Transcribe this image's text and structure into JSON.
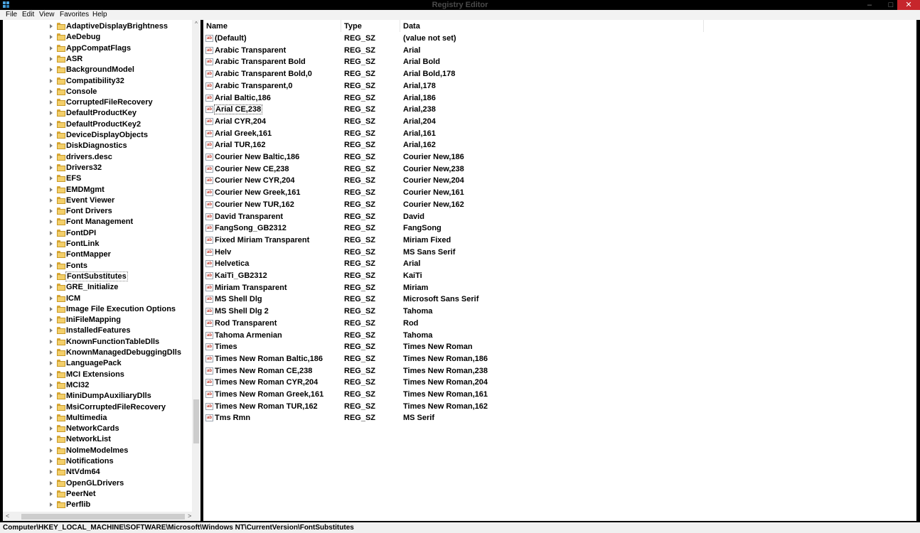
{
  "window": {
    "title": "Registry Editor",
    "minimize_glyph": "–",
    "maximize_glyph": "□",
    "close_glyph": "✕"
  },
  "menu": [
    "File",
    "Edit",
    "View",
    "Favorites",
    "Help"
  ],
  "tree": {
    "items": [
      "AdaptiveDisplayBrightness",
      "AeDebug",
      "AppCompatFlags",
      "ASR",
      "BackgroundModel",
      "Compatibility32",
      "Console",
      "CorruptedFileRecovery",
      "DefaultProductKey",
      "DefaultProductKey2",
      "DeviceDisplayObjects",
      "DiskDiagnostics",
      "drivers.desc",
      "Drivers32",
      "EFS",
      "EMDMgmt",
      "Event Viewer",
      "Font Drivers",
      "Font Management",
      "FontDPI",
      "FontLink",
      "FontMapper",
      "Fonts",
      "FontSubstitutes",
      "GRE_Initialize",
      "ICM",
      "Image File Execution Options",
      "IniFileMapping",
      "InstalledFeatures",
      "KnownFunctionTableDlls",
      "KnownManagedDebuggingDlls",
      "LanguagePack",
      "MCI Extensions",
      "MCI32",
      "MiniDumpAuxiliaryDlls",
      "MsiCorruptedFileRecovery",
      "Multimedia",
      "NetworkCards",
      "NetworkList",
      "NoImeModelmes",
      "Notifications",
      "NtVdm64",
      "OpenGLDrivers",
      "PeerNet",
      "Perflib"
    ],
    "selected": "FontSubstitutes",
    "scroll_up_glyph": "^",
    "scroll_left_glyph": "<",
    "scroll_right_glyph": ">"
  },
  "list": {
    "columns": [
      "Name",
      "Type",
      "Data"
    ],
    "icon_text": "ab",
    "focused": "Arial CE,238",
    "rows": [
      {
        "name": "(Default)",
        "type": "REG_SZ",
        "data": "(value not set)"
      },
      {
        "name": "Arabic Transparent",
        "type": "REG_SZ",
        "data": "Arial"
      },
      {
        "name": "Arabic Transparent Bold",
        "type": "REG_SZ",
        "data": "Arial Bold"
      },
      {
        "name": "Arabic Transparent Bold,0",
        "type": "REG_SZ",
        "data": "Arial Bold,178"
      },
      {
        "name": "Arabic Transparent,0",
        "type": "REG_SZ",
        "data": "Arial,178"
      },
      {
        "name": "Arial Baltic,186",
        "type": "REG_SZ",
        "data": "Arial,186"
      },
      {
        "name": "Arial CE,238",
        "type": "REG_SZ",
        "data": "Arial,238"
      },
      {
        "name": "Arial CYR,204",
        "type": "REG_SZ",
        "data": "Arial,204"
      },
      {
        "name": "Arial Greek,161",
        "type": "REG_SZ",
        "data": "Arial,161"
      },
      {
        "name": "Arial TUR,162",
        "type": "REG_SZ",
        "data": "Arial,162"
      },
      {
        "name": "Courier New Baltic,186",
        "type": "REG_SZ",
        "data": "Courier New,186"
      },
      {
        "name": "Courier New CE,238",
        "type": "REG_SZ",
        "data": "Courier New,238"
      },
      {
        "name": "Courier New CYR,204",
        "type": "REG_SZ",
        "data": "Courier New,204"
      },
      {
        "name": "Courier New Greek,161",
        "type": "REG_SZ",
        "data": "Courier New,161"
      },
      {
        "name": "Courier New TUR,162",
        "type": "REG_SZ",
        "data": "Courier New,162"
      },
      {
        "name": "David Transparent",
        "type": "REG_SZ",
        "data": "David"
      },
      {
        "name": "FangSong_GB2312",
        "type": "REG_SZ",
        "data": "FangSong"
      },
      {
        "name": "Fixed Miriam Transparent",
        "type": "REG_SZ",
        "data": "Miriam Fixed"
      },
      {
        "name": "Helv",
        "type": "REG_SZ",
        "data": "MS Sans Serif"
      },
      {
        "name": "Helvetica",
        "type": "REG_SZ",
        "data": "Arial"
      },
      {
        "name": "KaiTi_GB2312",
        "type": "REG_SZ",
        "data": "KaiTi"
      },
      {
        "name": "Miriam Transparent",
        "type": "REG_SZ",
        "data": "Miriam"
      },
      {
        "name": "MS Shell Dlg",
        "type": "REG_SZ",
        "data": "Microsoft Sans Serif"
      },
      {
        "name": "MS Shell Dlg 2",
        "type": "REG_SZ",
        "data": "Tahoma"
      },
      {
        "name": "Rod Transparent",
        "type": "REG_SZ",
        "data": "Rod"
      },
      {
        "name": "Tahoma Armenian",
        "type": "REG_SZ",
        "data": "Tahoma"
      },
      {
        "name": "Times",
        "type": "REG_SZ",
        "data": "Times New Roman"
      },
      {
        "name": "Times New Roman Baltic,186",
        "type": "REG_SZ",
        "data": "Times New Roman,186"
      },
      {
        "name": "Times New Roman CE,238",
        "type": "REG_SZ",
        "data": "Times New Roman,238"
      },
      {
        "name": "Times New Roman CYR,204",
        "type": "REG_SZ",
        "data": "Times New Roman,204"
      },
      {
        "name": "Times New Roman Greek,161",
        "type": "REG_SZ",
        "data": "Times New Roman,161"
      },
      {
        "name": "Times New Roman TUR,162",
        "type": "REG_SZ",
        "data": "Times New Roman,162"
      },
      {
        "name": "Tms Rmn",
        "type": "REG_SZ",
        "data": "MS Serif"
      }
    ]
  },
  "status": {
    "path": "Computer\\HKEY_LOCAL_MACHINE\\SOFTWARE\\Microsoft\\Windows NT\\CurrentVersion\\FontSubstitutes"
  },
  "colors": {
    "title_bg": "#000000",
    "close_button": "#c6262c",
    "folder": "#f3cf6a",
    "string_icon": "#c0392b"
  }
}
